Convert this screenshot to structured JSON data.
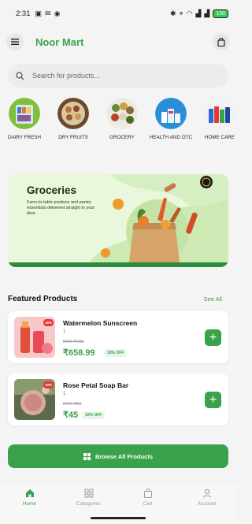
{
  "status_bar": {
    "time": "2:31",
    "battery": "100"
  },
  "header": {
    "brand": "Noor Mart"
  },
  "search": {
    "placeholder": "Search for products..."
  },
  "categories": [
    {
      "label": "DAIRY FRESH"
    },
    {
      "label": "DRY FRUITS"
    },
    {
      "label": "GROCERY"
    },
    {
      "label": "HEALTH AND OTC"
    },
    {
      "label": "HOME CARE"
    }
  ],
  "banner": {
    "title": "Groceries",
    "subtitle": "Farm-to-table produce and pantry essentials delivered straight to your door."
  },
  "featured": {
    "title": "Featured Products",
    "see_all": "See All"
  },
  "products": [
    {
      "badge": "18%",
      "name": "Watermelon Sunscreen",
      "qty": "1",
      "mrp": "MRP ₹799",
      "price": "₹658.99",
      "off": "18% OFF"
    },
    {
      "badge": "10%",
      "name": "Rose Petal Soap Bar",
      "qty": "1",
      "mrp": "MRP ₹50",
      "price": "₹45",
      "off": "10% OFF"
    }
  ],
  "browse_button": {
    "label": "Browse All Products"
  },
  "bottom_nav": [
    {
      "label": "Home"
    },
    {
      "label": "Categories"
    },
    {
      "label": "Cart"
    },
    {
      "label": "Account"
    }
  ],
  "colors": {
    "accent": "#3aa24a",
    "badge": "#e53935",
    "banner_bg": "#e9f7dc"
  }
}
